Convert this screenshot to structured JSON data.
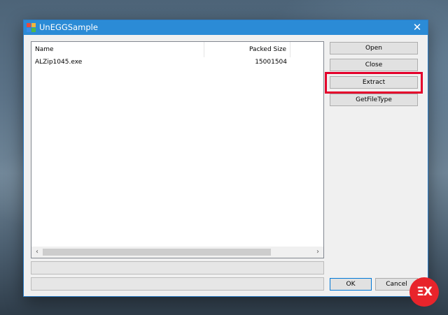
{
  "window": {
    "title": "UnEGGSample",
    "close_glyph": "✕",
    "title_bar_color": "#2b8bd6"
  },
  "listview": {
    "columns": {
      "name": "Name",
      "packed_size": "Packed Size"
    },
    "rows": [
      {
        "name": "ALZip1045.exe",
        "packed_size": "15001504"
      }
    ],
    "scroll_left_glyph": "‹",
    "scroll_right_glyph": "›"
  },
  "buttons": {
    "open": "Open",
    "close": "Close",
    "extract": "Extract",
    "getfiletype": "GetFileType",
    "ok": "OK",
    "cancel": "Cancel"
  },
  "icons": {
    "app": "app-icon",
    "close": "close-icon",
    "scroll_left": "chevron-left-icon",
    "scroll_right": "chevron-right-icon"
  },
  "colors": {
    "highlight": "#e4002b",
    "logo": "#e8242b"
  },
  "logo": {
    "text": "ΞX"
  }
}
